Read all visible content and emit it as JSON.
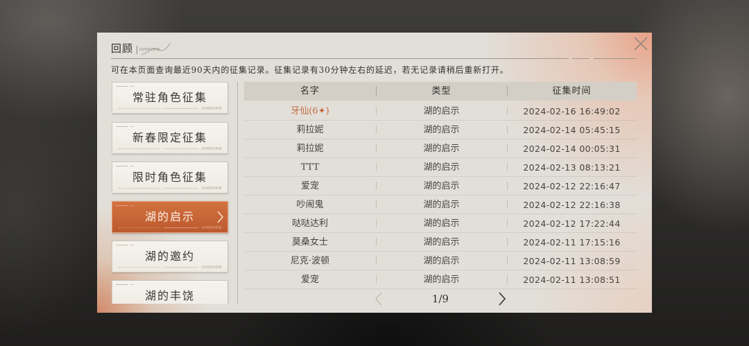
{
  "panel": {
    "title": "回顾",
    "title_tag": "OVERVIEW",
    "description": "可在本页面查询最近90天内的征集记录。征集记录有30分钟左右的延迟，若无记录请稍后重新打开。",
    "close_icon": "close-icon"
  },
  "sidebar": {
    "decor_tag": "OVERVIEW",
    "selected_icon": "chevron-right-icon",
    "items": [
      {
        "label": "常驻角色征集",
        "selected": false
      },
      {
        "label": "新春限定征集",
        "selected": false
      },
      {
        "label": "限时角色征集",
        "selected": false
      },
      {
        "label": "湖的启示",
        "selected": true
      },
      {
        "label": "湖的邀约",
        "selected": false
      },
      {
        "label": "湖的丰饶",
        "selected": false
      }
    ]
  },
  "table": {
    "headers": [
      "名字",
      "类型",
      "征集时间"
    ],
    "rows": [
      {
        "name": "牙仙(6✦)",
        "type": "湖的启示",
        "time": "2024-02-16 16:49:02",
        "highlight": true
      },
      {
        "name": "莉拉妮",
        "type": "湖的启示",
        "time": "2024-02-14 05:45:15",
        "highlight": false
      },
      {
        "name": "莉拉妮",
        "type": "湖的启示",
        "time": "2024-02-14 00:05:31",
        "highlight": false
      },
      {
        "name": "TTT",
        "type": "湖的启示",
        "time": "2024-02-13 08:13:21",
        "highlight": false
      },
      {
        "name": "爱宠",
        "type": "湖的启示",
        "time": "2024-02-12 22:16:47",
        "highlight": false
      },
      {
        "name": "吵闹鬼",
        "type": "湖的启示",
        "time": "2024-02-12 22:16:38",
        "highlight": false
      },
      {
        "name": "哒哒达利",
        "type": "湖的启示",
        "time": "2024-02-12 17:22:44",
        "highlight": false
      },
      {
        "name": "莫桑女士",
        "type": "湖的启示",
        "time": "2024-02-11 17:15:16",
        "highlight": false
      },
      {
        "name": "尼克·波顿",
        "type": "湖的启示",
        "time": "2024-02-11 13:08:59",
        "highlight": false
      },
      {
        "name": "爱宠",
        "type": "湖的启示",
        "time": "2024-02-11 13:08:51",
        "highlight": false
      }
    ]
  },
  "pagination": {
    "current": "1/9",
    "prev_icon": "chevron-left-icon",
    "next_icon": "chevron-right-icon"
  },
  "colors": {
    "accent": "#c8663c",
    "highlight_text": "#c46a3c",
    "panel_bg": "#e2dfd9"
  }
}
